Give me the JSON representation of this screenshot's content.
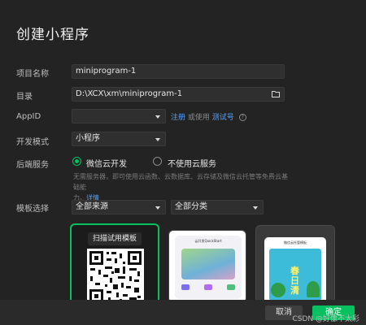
{
  "dialog": {
    "title": "创建小程序"
  },
  "form": {
    "project_name_label": "项目名称",
    "project_name_value": "miniprogram-1",
    "dir_label": "目录",
    "dir_value": "D:\\XCX\\xm\\miniprogram-1",
    "appid_label": "AppID",
    "appid_value": "",
    "appid_register": "注册",
    "appid_or": "或使用",
    "appid_test": "测试号",
    "dev_mode_label": "开发模式",
    "dev_mode_value": "小程序",
    "backend_label": "后端服务",
    "backend_option_cloud": "微信云开发",
    "backend_option_none": "不使用云服务",
    "backend_desc_line1": "无需服务器，即可使用云函数、云数据库、云存储及微信云托管等免费云基础能",
    "backend_desc_line2": "力。",
    "backend_desc_detail": "详情",
    "template_label": "模板选择",
    "template_source": "全部来源",
    "template_category": "全部分类"
  },
  "templates": {
    "qr_caption": "扫描试用模板",
    "card2_title": "云开发QuickStart",
    "card3_title": "微信云托管模板"
  },
  "footer": {
    "cancel_label": "取消",
    "confirm_label": "确定",
    "watermark": "CSDN @好像不太彩"
  },
  "colors": {
    "accent": "#07c160",
    "link": "#5aa0f0",
    "bg": "#232323"
  }
}
